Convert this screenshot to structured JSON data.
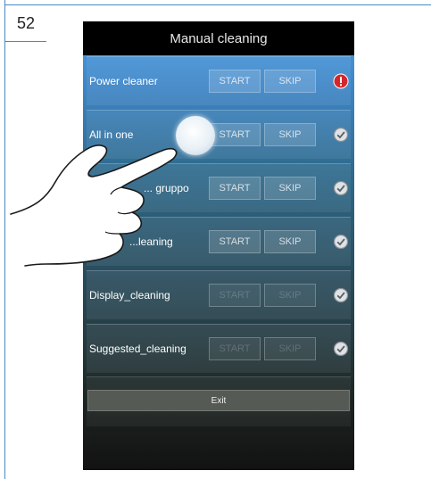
{
  "page_number": "52",
  "screen": {
    "title": "Manual cleaning",
    "rows": [
      {
        "label": "Power cleaner",
        "start": "START",
        "skip": "SKIP",
        "status": "alert",
        "dim": false
      },
      {
        "label": "All in one",
        "start": "START",
        "skip": "SKIP",
        "status": "check",
        "dim": false
      },
      {
        "label": "... gruppo",
        "start": "START",
        "skip": "SKIP",
        "status": "check",
        "dim": false
      },
      {
        "label": "...leaning",
        "start": "START",
        "skip": "SKIP",
        "status": "check",
        "dim": false
      },
      {
        "label": "Display_cleaning",
        "start": "START",
        "skip": "SKIP",
        "status": "check",
        "dim": true
      },
      {
        "label": "Suggested_cleaning",
        "start": "START",
        "skip": "SKIP",
        "status": "check",
        "dim": true
      }
    ],
    "exit_label": "Exit"
  },
  "colors": {
    "alert": "#d7262b",
    "check_fill": "#dfe3e6",
    "frame": "#4a88c4"
  },
  "icons": {
    "alert": "exclamation-icon",
    "check": "check-circle-icon",
    "hand": "pointing-hand-icon"
  }
}
